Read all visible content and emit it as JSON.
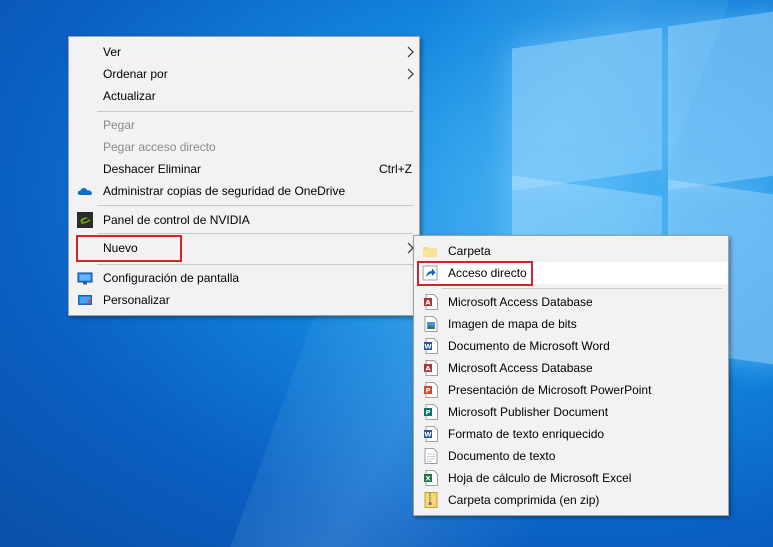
{
  "main_menu": {
    "items": [
      {
        "label": "Ver",
        "has_submenu": true
      },
      {
        "label": "Ordenar por",
        "has_submenu": true
      },
      {
        "label": "Actualizar"
      },
      {
        "label": "Pegar",
        "disabled": true
      },
      {
        "label": "Pegar acceso directo",
        "disabled": true
      },
      {
        "label": "Deshacer Eliminar",
        "shortcut": "Ctrl+Z"
      },
      {
        "label": "Administrar copias de seguridad de OneDrive",
        "icon": "onedrive-icon"
      },
      {
        "label": "Panel de control de NVIDIA",
        "icon": "nvidia-icon"
      },
      {
        "label": "Nuevo",
        "has_submenu": true,
        "highlighted": true
      },
      {
        "label": "Configuración de pantalla",
        "icon": "display-settings-icon"
      },
      {
        "label": "Personalizar",
        "icon": "personalize-icon"
      }
    ]
  },
  "new_submenu": {
    "items": [
      {
        "label": "Carpeta",
        "icon": "folder-icon"
      },
      {
        "label": "Acceso directo",
        "icon": "shortcut-icon",
        "highlighted": true
      },
      {
        "label": "Microsoft Access Database",
        "icon": "access-icon"
      },
      {
        "label": "Imagen de mapa de bits",
        "icon": "bitmap-icon"
      },
      {
        "label": "Documento de Microsoft Word",
        "icon": "word-icon"
      },
      {
        "label": "Microsoft Access Database",
        "icon": "access-icon"
      },
      {
        "label": "Presentación de Microsoft PowerPoint",
        "icon": "powerpoint-icon"
      },
      {
        "label": "Microsoft Publisher Document",
        "icon": "publisher-icon"
      },
      {
        "label": "Formato de texto enriquecido",
        "icon": "rtf-icon"
      },
      {
        "label": "Documento de texto",
        "icon": "text-document-icon"
      },
      {
        "label": "Hoja de cálculo de Microsoft Excel",
        "icon": "excel-icon"
      },
      {
        "label": "Carpeta comprimida (en zip)",
        "icon": "zip-folder-icon"
      }
    ]
  },
  "colors": {
    "highlight_border": "#d4232a",
    "menu_background": "#f2f2f2",
    "disabled_text": "#8a8a8a",
    "desktop_blue": "#1489e0"
  }
}
